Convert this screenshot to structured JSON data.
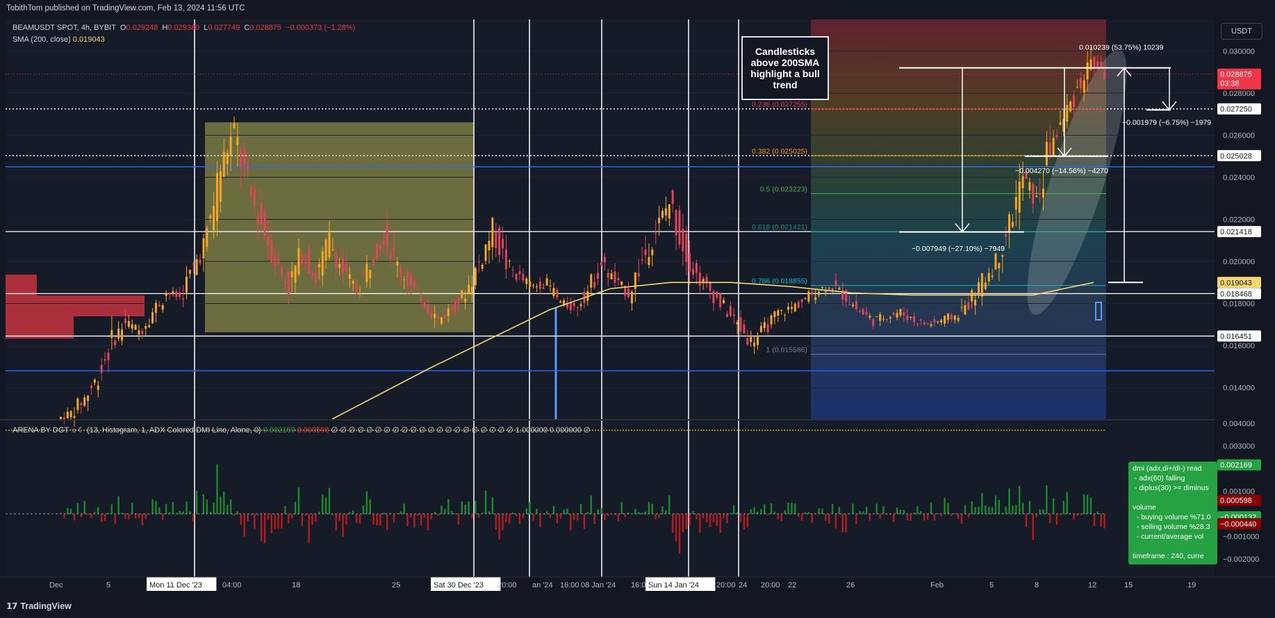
{
  "header": {
    "published_text": "TobithTom published on TradingView.com, Feb 13, 2024 11:56 UTC"
  },
  "legend": {
    "symbol": "BEAMUSDT SPOT, 4h, BYBIT",
    "ohlc": [
      {
        "label": "O",
        "value": "0.029248"
      },
      {
        "label": "H",
        "value": "0.029380"
      },
      {
        "label": "L",
        "value": "0.027749"
      },
      {
        "label": "C",
        "value": "0.028875"
      }
    ],
    "change": "−0.000373 (−1.28%)",
    "sma_label": "SMA (200, close)",
    "sma_value": "0.019043",
    "indicator_label": "ARENA BY DGT ☼☾ (13, Histogram, 1, ADX Colored DMI Line, Alone, 0)",
    "indicator_v1": "0.002169",
    "indicator_v2": "0.000598",
    "indicator_rest": "∅ ∅ ∅ ∅ ∅ ∅ ∅ ∅ ∅ ∅ ∅ ∅ ∅ ∅ ∅ ∅ ∅ ∅ ∅ ∅ ∅ 1.000000 0.000000 ∅"
  },
  "currency_button": "USDT",
  "brand": "TradingView",
  "annotation_box": "Candlesticks above 200SMA highlight a bull trend",
  "side_panel_text": "dmi (adx,di+/di-) read\n - adx(60) falling\n - diplus(30) >= diminus\n\nvolume\n  - buying volume %71.0\n  - selling volume %28.3\n  - current/average vol\n\ntimeframe : 240, curre",
  "colors": {
    "background": "#131722",
    "up": "#f5a623",
    "down": "#e0455a",
    "sma": "#f5d76e",
    "hist_up": "#1b8a2a",
    "hist_down": "#b71c1c",
    "blue_line": "#2962ff",
    "highlight_zone": "#b5b052"
  },
  "chart_data": {
    "type": "candlestick",
    "title": "BEAMUSDT SPOT, 4h, BYBIT",
    "ylim": [
      0.0125,
      0.0315
    ],
    "y_ticks": [
      "0.030000",
      "0.028000",
      "0.026000",
      "0.024000",
      "0.022000",
      "0.020000",
      "0.018000",
      "0.016000",
      "0.014000"
    ],
    "y_tick_values": [
      0.03,
      0.028,
      0.026,
      0.024,
      0.022,
      0.02,
      0.018,
      0.016,
      0.014
    ],
    "indicator_ylim": [
      -0.0028,
      0.0041
    ],
    "indicator_ticks": [
      "0.004000",
      "0.003000",
      "0.001000",
      "−0.001000",
      "−0.002000"
    ],
    "indicator_tick_values": [
      0.004,
      0.003,
      0.001,
      -0.001,
      -0.002
    ],
    "x_ticks": [
      "Dec",
      "5",
      "Mon 11 Dec '23",
      "04:00",
      "18",
      "25",
      "Sat 30 Dec '23",
      "20:00",
      "an '24",
      "16:00",
      "08 Jan '24",
      "16:00",
      "Sun 14 Jan '24",
      "20:00",
      "24",
      "20:00",
      "22",
      "26",
      "Feb",
      "5",
      "8",
      "12",
      "15",
      "19"
    ],
    "price_path": [
      [
        0.0125,
        0.0128
      ],
      [
        0.0128,
        0.0135
      ],
      [
        0.0135,
        0.0145
      ],
      [
        0.0145,
        0.0162
      ],
      [
        0.0162,
        0.0171
      ],
      [
        0.0171,
        0.0167
      ],
      [
        0.0167,
        0.0176
      ],
      [
        0.0176,
        0.0185
      ],
      [
        0.0185,
        0.0183
      ],
      [
        0.0183,
        0.0197
      ],
      [
        0.0197,
        0.0212
      ],
      [
        0.0212,
        0.0245
      ],
      [
        0.0245,
        0.0262
      ],
      [
        0.0262,
        0.0235
      ],
      [
        0.0235,
        0.0218
      ],
      [
        0.0218,
        0.0201
      ],
      [
        0.0201,
        0.0188
      ],
      [
        0.0188,
        0.0205
      ],
      [
        0.0205,
        0.0192
      ],
      [
        0.0192,
        0.021
      ],
      [
        0.021,
        0.0195
      ],
      [
        0.0195,
        0.0186
      ],
      [
        0.0186,
        0.02
      ],
      [
        0.02,
        0.0213
      ],
      [
        0.0213,
        0.0198
      ],
      [
        0.0198,
        0.0188
      ],
      [
        0.0188,
        0.0181
      ],
      [
        0.0181,
        0.0172
      ],
      [
        0.0172,
        0.0178
      ],
      [
        0.0178,
        0.0185
      ],
      [
        0.0185,
        0.0199
      ],
      [
        0.0199,
        0.0215
      ],
      [
        0.0215,
        0.0199
      ],
      [
        0.0199,
        0.0192
      ],
      [
        0.0192,
        0.0188
      ],
      [
        0.0188,
        0.019
      ],
      [
        0.019,
        0.018
      ],
      [
        0.018,
        0.0178
      ],
      [
        0.0178,
        0.0186
      ],
      [
        0.0186,
        0.0199
      ],
      [
        0.0199,
        0.019
      ],
      [
        0.019,
        0.0185
      ],
      [
        0.0185,
        0.02
      ],
      [
        0.02,
        0.0215
      ],
      [
        0.0215,
        0.0228
      ],
      [
        0.0228,
        0.0208
      ],
      [
        0.0208,
        0.0193
      ],
      [
        0.0193,
        0.0186
      ],
      [
        0.0186,
        0.0178
      ],
      [
        0.0178,
        0.017
      ],
      [
        0.017,
        0.0162
      ],
      [
        0.0162,
        0.0168
      ],
      [
        0.0168,
        0.0175
      ],
      [
        0.0175,
        0.0178
      ],
      [
        0.0178,
        0.0182
      ],
      [
        0.0182,
        0.0187
      ],
      [
        0.0187,
        0.0188
      ],
      [
        0.0188,
        0.0183
      ],
      [
        0.0183,
        0.0176
      ],
      [
        0.0176,
        0.0172
      ],
      [
        0.0172,
        0.0174
      ],
      [
        0.0174,
        0.0176
      ],
      [
        0.0176,
        0.0172
      ],
      [
        0.0172,
        0.017
      ],
      [
        0.017,
        0.0172
      ],
      [
        0.0172,
        0.0174
      ],
      [
        0.0174,
        0.018
      ],
      [
        0.018,
        0.019
      ],
      [
        0.019,
        0.02
      ],
      [
        0.02,
        0.0218
      ],
      [
        0.0218,
        0.024
      ],
      [
        0.024,
        0.0228
      ],
      [
        0.0228,
        0.0255
      ],
      [
        0.0255,
        0.0268
      ],
      [
        0.0268,
        0.0282
      ],
      [
        0.0282,
        0.0295
      ],
      [
        0.0295,
        0.0289
      ]
    ],
    "sma_200": {
      "label": "SMA (200, close)",
      "x_frac": [
        0.27,
        0.3,
        0.35,
        0.4,
        0.45,
        0.5,
        0.55,
        0.6,
        0.65,
        0.7,
        0.75,
        0.8,
        0.85,
        0.9
      ],
      "values": [
        0.0125,
        0.0134,
        0.0149,
        0.0163,
        0.0177,
        0.0187,
        0.019,
        0.019,
        0.0188,
        0.0185,
        0.0184,
        0.0184,
        0.0184,
        0.019
      ]
    },
    "horizontal_levels": [
      {
        "value": 0.02725,
        "label": "0.027250",
        "style": "dotted"
      },
      {
        "value": 0.025028,
        "label": "0.025028",
        "style": "dotted"
      },
      {
        "value": 0.021418,
        "label": "0.021418",
        "style": "solid"
      },
      {
        "value": 0.018468,
        "label": "0.018468",
        "style": "solid"
      },
      {
        "value": 0.016451,
        "label": "0.016451",
        "style": "solid"
      }
    ],
    "blue_levels": [
      0.0245,
      0.0148
    ],
    "fibonacci": [
      {
        "ratio": "0.236",
        "value": 0.027255,
        "label": "0.236 (0.027255)",
        "color": "#f23645"
      },
      {
        "ratio": "0.382",
        "value": 0.025025,
        "label": "0.382 (0.025025)",
        "color": "#ff9800"
      },
      {
        "ratio": "0.5",
        "value": 0.023223,
        "label": "0.5 (0.023223)",
        "color": "#4caf50"
      },
      {
        "ratio": "0.618",
        "value": 0.021421,
        "label": "0.618 (0.021421)",
        "color": "#089981"
      },
      {
        "ratio": "0.786",
        "value": 0.018855,
        "label": "0.786 (0.018855)",
        "color": "#00bcd4"
      },
      {
        "ratio": "1",
        "value": 0.015586,
        "label": "1 (0.015586)",
        "color": "#787b86"
      }
    ],
    "measurements": [
      {
        "label": "0.010239 (53.75%) 10239"
      },
      {
        "label": "−0.001979 (−6.75%) −1979"
      },
      {
        "label": "−0.004270 (−14.56%) −4270"
      },
      {
        "label": "−0.007949 (−27.10%) −7949"
      }
    ],
    "price_labels": [
      {
        "value": "0.028875",
        "sub": "03:38",
        "bg": "#f23645"
      },
      {
        "value": "0.019043",
        "bg": "#f5d76e"
      },
      {
        "value": "0.002169",
        "bg": "#26a243"
      },
      {
        "value": "0.000598",
        "bg": "#8b0000"
      },
      {
        "value": "−0.000132",
        "bg": "#26a243"
      },
      {
        "value": "−0.000440",
        "bg": "#8b0000"
      }
    ]
  }
}
